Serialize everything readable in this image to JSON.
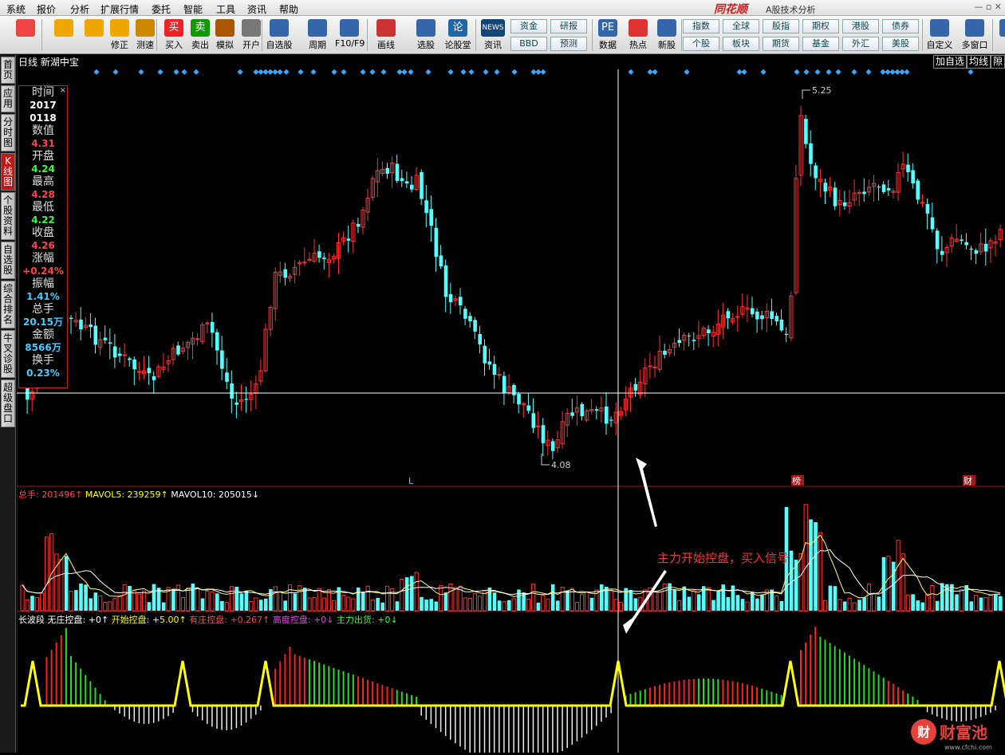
{
  "menu": [
    "系统",
    "报价",
    "分析",
    "扩展行情",
    "委托",
    "智能",
    "工具",
    "资讯",
    "帮助"
  ],
  "brand": "同花顺",
  "app_title": "A股技术分析",
  "toolbar": [
    {
      "label": "",
      "icon": "grid-icon",
      "c": "#e44"
    },
    {
      "label": "",
      "icon": "back-arrow-icon",
      "c": "#f0a800"
    },
    {
      "label": "",
      "icon": "up-down-icon",
      "c": "#f0a800"
    },
    {
      "label": "修正",
      "icon": "fix-icon",
      "c": "#f0a800"
    },
    {
      "label": "测速",
      "icon": "clock-icon",
      "c": "#c80"
    },
    {
      "label": "买入",
      "icon": "buy-icon",
      "c": "#e22",
      "t": "买"
    },
    {
      "label": "卖出",
      "icon": "sell-icon",
      "c": "#190",
      "t": "卖"
    },
    {
      "label": "模拟",
      "icon": "hammer-icon",
      "c": "#a50"
    },
    {
      "label": "开户",
      "icon": "lock-icon",
      "c": "#777"
    },
    {
      "label": "自选股",
      "icon": "star-folder-icon",
      "c": "#36a"
    },
    {
      "label": "周期",
      "icon": "cycle-icon",
      "c": "#36a"
    },
    {
      "label": "F10/F9",
      "icon": "f10-icon",
      "c": "#36a"
    },
    {
      "label": "画线",
      "icon": "pen-icon",
      "c": "#c33"
    },
    {
      "label": "选股",
      "icon": "screen-icon",
      "c": "#36a"
    },
    {
      "label": "论股堂",
      "icon": "forum-icon",
      "c": "#26a",
      "t": "论"
    },
    {
      "label": "资讯",
      "icon": "news-icon",
      "c": "#147",
      "t": "NEWS"
    },
    {
      "label": "数据",
      "icon": "pe-icon",
      "c": "#36a",
      "t": "PE"
    },
    {
      "label": "热点",
      "icon": "hot-icon",
      "c": "#d33"
    },
    {
      "label": "新股",
      "icon": "new-stock-icon",
      "c": "#36a"
    },
    {
      "label": "自定义",
      "icon": "custom-icon",
      "c": "#36a"
    },
    {
      "label": "多窗口",
      "icon": "multi-window-icon",
      "c": "#36a"
    },
    {
      "label": "",
      "icon": "more-icon",
      "c": "#36a"
    }
  ],
  "small_buttons": [
    "资金",
    "研报",
    "BBD",
    "预测",
    "指数",
    "全球",
    "股指",
    "期权",
    "港股",
    "债券",
    "个股",
    "板块",
    "期货",
    "基金",
    "外汇",
    "美股"
  ],
  "left_tabs": [
    "首页",
    "应用",
    "分时图",
    "K线图",
    "个股资料",
    "自选股",
    "综合排名",
    "牛叉诊股",
    "超级盘口"
  ],
  "chart": {
    "period": "日线",
    "name": "新湖中宝",
    "top_buttons": [
      "加自选",
      "均线",
      "隙"
    ],
    "high_label": "5.25",
    "low_label": "4.08",
    "markers": [
      "L",
      "榜",
      "财"
    ]
  },
  "info": {
    "close": "×",
    "rows": [
      [
        "时间",
        "2017\n0118",
        "#fff"
      ],
      [
        "数值",
        "4.31",
        "#f44"
      ],
      [
        "开盘",
        "4.24",
        "#3f3"
      ],
      [
        "最高",
        "4.28",
        "#f44"
      ],
      [
        "最低",
        "4.22",
        "#3f3"
      ],
      [
        "收盘",
        "4.26",
        "#f44"
      ],
      [
        "涨幅",
        "+0.24%",
        "#f44"
      ],
      [
        "振幅",
        "1.41%",
        "#4cf"
      ],
      [
        "总手",
        "20.15万",
        "#4cf"
      ],
      [
        "金额",
        "8566万",
        "#4cf"
      ],
      [
        "换手",
        "0.23%",
        "#4cf"
      ]
    ]
  },
  "vol_panel": {
    "label1": "总手: 201496",
    "label2": "MAVOL5: 239259",
    "label3": "MAVOL10: 205015"
  },
  "ind_panel": {
    "name": "长波段",
    "label1": "无庄控盘: +0",
    "label2": "开始控盘: +5.00",
    "label3": "有庄控盘: +0.267",
    "label4": "高度控盘: +0",
    "label5": "主力出货: +0"
  },
  "annotation": "主力开始控盘，买入信号",
  "watermark": {
    "text": "财富池",
    "url": "www.cfchi.com"
  }
}
